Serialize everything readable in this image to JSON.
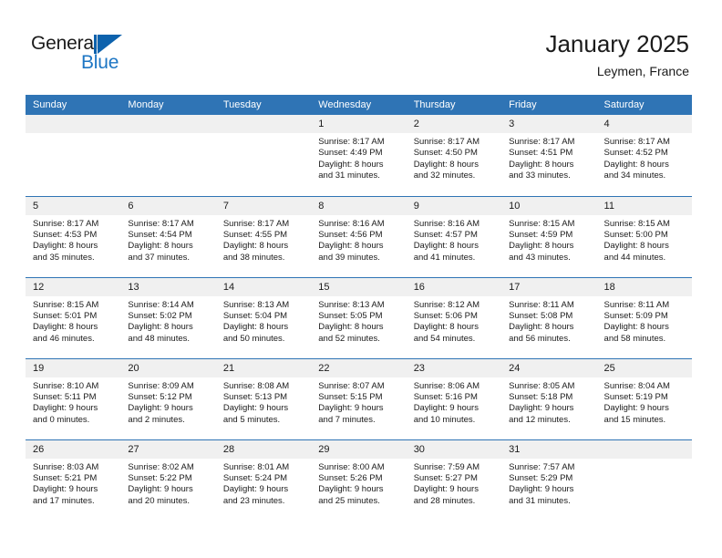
{
  "brand": {
    "name_top": "General",
    "name_bottom": "Blue",
    "sail_icon": "triangle-sail-icon",
    "accent_color": "#1d76c4",
    "dark_color": "#0d62ad"
  },
  "header": {
    "title": "January 2025",
    "subtitle": "Leymen, France"
  },
  "theme": {
    "header_bg": "#2f74b5",
    "daynum_bg": "#f0f0f0",
    "text": "#1b1b1b"
  },
  "weekdays": [
    "Sunday",
    "Monday",
    "Tuesday",
    "Wednesday",
    "Thursday",
    "Friday",
    "Saturday"
  ],
  "weeks": [
    [
      {
        "day": "",
        "empty": true,
        "lines": []
      },
      {
        "day": "",
        "empty": true,
        "lines": []
      },
      {
        "day": "",
        "empty": true,
        "lines": []
      },
      {
        "day": "1",
        "empty": false,
        "lines": [
          "Sunrise: 8:17 AM",
          "Sunset: 4:49 PM",
          "Daylight: 8 hours",
          "and 31 minutes."
        ]
      },
      {
        "day": "2",
        "empty": false,
        "lines": [
          "Sunrise: 8:17 AM",
          "Sunset: 4:50 PM",
          "Daylight: 8 hours",
          "and 32 minutes."
        ]
      },
      {
        "day": "3",
        "empty": false,
        "lines": [
          "Sunrise: 8:17 AM",
          "Sunset: 4:51 PM",
          "Daylight: 8 hours",
          "and 33 minutes."
        ]
      },
      {
        "day": "4",
        "empty": false,
        "lines": [
          "Sunrise: 8:17 AM",
          "Sunset: 4:52 PM",
          "Daylight: 8 hours",
          "and 34 minutes."
        ]
      }
    ],
    [
      {
        "day": "5",
        "empty": false,
        "lines": [
          "Sunrise: 8:17 AM",
          "Sunset: 4:53 PM",
          "Daylight: 8 hours",
          "and 35 minutes."
        ]
      },
      {
        "day": "6",
        "empty": false,
        "lines": [
          "Sunrise: 8:17 AM",
          "Sunset: 4:54 PM",
          "Daylight: 8 hours",
          "and 37 minutes."
        ]
      },
      {
        "day": "7",
        "empty": false,
        "lines": [
          "Sunrise: 8:17 AM",
          "Sunset: 4:55 PM",
          "Daylight: 8 hours",
          "and 38 minutes."
        ]
      },
      {
        "day": "8",
        "empty": false,
        "lines": [
          "Sunrise: 8:16 AM",
          "Sunset: 4:56 PM",
          "Daylight: 8 hours",
          "and 39 minutes."
        ]
      },
      {
        "day": "9",
        "empty": false,
        "lines": [
          "Sunrise: 8:16 AM",
          "Sunset: 4:57 PM",
          "Daylight: 8 hours",
          "and 41 minutes."
        ]
      },
      {
        "day": "10",
        "empty": false,
        "lines": [
          "Sunrise: 8:15 AM",
          "Sunset: 4:59 PM",
          "Daylight: 8 hours",
          "and 43 minutes."
        ]
      },
      {
        "day": "11",
        "empty": false,
        "lines": [
          "Sunrise: 8:15 AM",
          "Sunset: 5:00 PM",
          "Daylight: 8 hours",
          "and 44 minutes."
        ]
      }
    ],
    [
      {
        "day": "12",
        "empty": false,
        "lines": [
          "Sunrise: 8:15 AM",
          "Sunset: 5:01 PM",
          "Daylight: 8 hours",
          "and 46 minutes."
        ]
      },
      {
        "day": "13",
        "empty": false,
        "lines": [
          "Sunrise: 8:14 AM",
          "Sunset: 5:02 PM",
          "Daylight: 8 hours",
          "and 48 minutes."
        ]
      },
      {
        "day": "14",
        "empty": false,
        "lines": [
          "Sunrise: 8:13 AM",
          "Sunset: 5:04 PM",
          "Daylight: 8 hours",
          "and 50 minutes."
        ]
      },
      {
        "day": "15",
        "empty": false,
        "lines": [
          "Sunrise: 8:13 AM",
          "Sunset: 5:05 PM",
          "Daylight: 8 hours",
          "and 52 minutes."
        ]
      },
      {
        "day": "16",
        "empty": false,
        "lines": [
          "Sunrise: 8:12 AM",
          "Sunset: 5:06 PM",
          "Daylight: 8 hours",
          "and 54 minutes."
        ]
      },
      {
        "day": "17",
        "empty": false,
        "lines": [
          "Sunrise: 8:11 AM",
          "Sunset: 5:08 PM",
          "Daylight: 8 hours",
          "and 56 minutes."
        ]
      },
      {
        "day": "18",
        "empty": false,
        "lines": [
          "Sunrise: 8:11 AM",
          "Sunset: 5:09 PM",
          "Daylight: 8 hours",
          "and 58 minutes."
        ]
      }
    ],
    [
      {
        "day": "19",
        "empty": false,
        "lines": [
          "Sunrise: 8:10 AM",
          "Sunset: 5:11 PM",
          "Daylight: 9 hours",
          "and 0 minutes."
        ]
      },
      {
        "day": "20",
        "empty": false,
        "lines": [
          "Sunrise: 8:09 AM",
          "Sunset: 5:12 PM",
          "Daylight: 9 hours",
          "and 2 minutes."
        ]
      },
      {
        "day": "21",
        "empty": false,
        "lines": [
          "Sunrise: 8:08 AM",
          "Sunset: 5:13 PM",
          "Daylight: 9 hours",
          "and 5 minutes."
        ]
      },
      {
        "day": "22",
        "empty": false,
        "lines": [
          "Sunrise: 8:07 AM",
          "Sunset: 5:15 PM",
          "Daylight: 9 hours",
          "and 7 minutes."
        ]
      },
      {
        "day": "23",
        "empty": false,
        "lines": [
          "Sunrise: 8:06 AM",
          "Sunset: 5:16 PM",
          "Daylight: 9 hours",
          "and 10 minutes."
        ]
      },
      {
        "day": "24",
        "empty": false,
        "lines": [
          "Sunrise: 8:05 AM",
          "Sunset: 5:18 PM",
          "Daylight: 9 hours",
          "and 12 minutes."
        ]
      },
      {
        "day": "25",
        "empty": false,
        "lines": [
          "Sunrise: 8:04 AM",
          "Sunset: 5:19 PM",
          "Daylight: 9 hours",
          "and 15 minutes."
        ]
      }
    ],
    [
      {
        "day": "26",
        "empty": false,
        "lines": [
          "Sunrise: 8:03 AM",
          "Sunset: 5:21 PM",
          "Daylight: 9 hours",
          "and 17 minutes."
        ]
      },
      {
        "day": "27",
        "empty": false,
        "lines": [
          "Sunrise: 8:02 AM",
          "Sunset: 5:22 PM",
          "Daylight: 9 hours",
          "and 20 minutes."
        ]
      },
      {
        "day": "28",
        "empty": false,
        "lines": [
          "Sunrise: 8:01 AM",
          "Sunset: 5:24 PM",
          "Daylight: 9 hours",
          "and 23 minutes."
        ]
      },
      {
        "day": "29",
        "empty": false,
        "lines": [
          "Sunrise: 8:00 AM",
          "Sunset: 5:26 PM",
          "Daylight: 9 hours",
          "and 25 minutes."
        ]
      },
      {
        "day": "30",
        "empty": false,
        "lines": [
          "Sunrise: 7:59 AM",
          "Sunset: 5:27 PM",
          "Daylight: 9 hours",
          "and 28 minutes."
        ]
      },
      {
        "day": "31",
        "empty": false,
        "lines": [
          "Sunrise: 7:57 AM",
          "Sunset: 5:29 PM",
          "Daylight: 9 hours",
          "and 31 minutes."
        ]
      },
      {
        "day": "",
        "empty": true,
        "lines": []
      }
    ]
  ]
}
